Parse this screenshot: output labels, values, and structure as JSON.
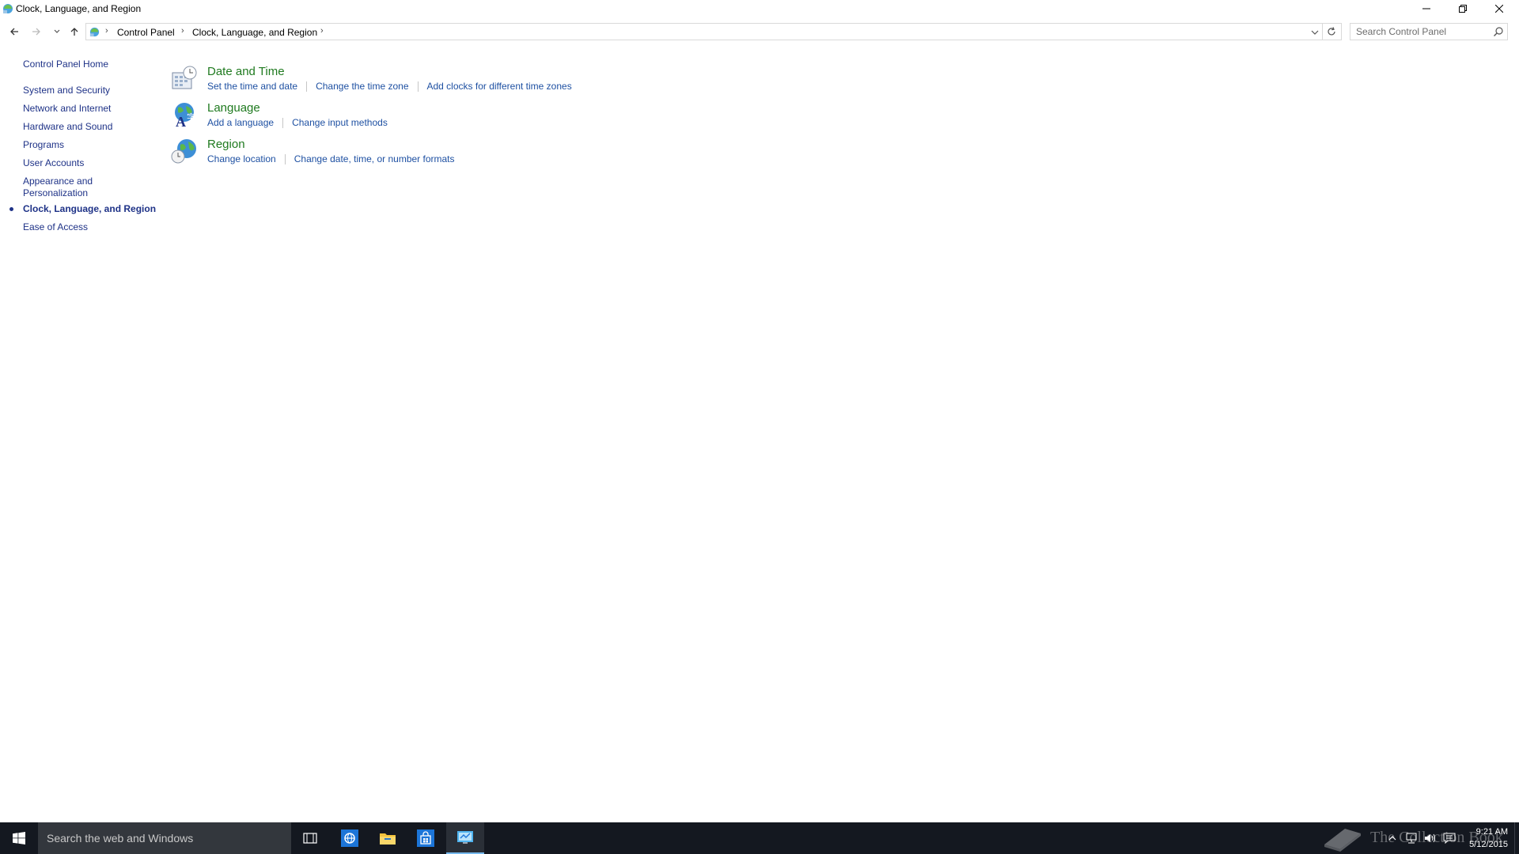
{
  "window": {
    "title": "Clock, Language, and Region",
    "icon": "control-panel-icon"
  },
  "navigation": {
    "back_icon": "back-arrow-icon",
    "forward_icon": "forward-arrow-icon",
    "recent_icon": "chevron-down-icon",
    "up_icon": "up-arrow-icon"
  },
  "address": {
    "crumbs": [
      "Control Panel",
      "Clock, Language, and Region"
    ]
  },
  "search": {
    "placeholder": "Search Control Panel"
  },
  "sidebar": {
    "items": [
      {
        "label": "Control Panel Home"
      },
      {
        "label": "System and Security"
      },
      {
        "label": "Network and Internet"
      },
      {
        "label": "Hardware and Sound"
      },
      {
        "label": "Programs"
      },
      {
        "label": "User Accounts"
      },
      {
        "label": "Appearance and",
        "label2": "Personalization"
      },
      {
        "label": "Clock, Language, and Region",
        "current": true
      },
      {
        "label": "Ease of Access"
      }
    ]
  },
  "categories": [
    {
      "title": "Date and Time",
      "icon": "date-time-icon",
      "links": [
        "Set the time and date",
        "Change the time zone",
        "Add clocks for different time zones"
      ]
    },
    {
      "title": "Language",
      "icon": "language-icon",
      "links": [
        "Add a language",
        "Change input methods"
      ]
    },
    {
      "title": "Region",
      "icon": "region-globe-icon",
      "links": [
        "Change location",
        "Change date, time, or number formats"
      ]
    }
  ],
  "taskbar": {
    "search_text": "Search the web and Windows",
    "apps": [
      "task-view-icon",
      "internet-explorer-icon",
      "file-explorer-icon",
      "store-icon",
      "control-panel-icon"
    ],
    "tray": [
      "show-hidden-icons-icon",
      "network-icon",
      "volume-icon",
      "action-center-icon"
    ],
    "time": "9:21 AM",
    "date": "5/12/2015"
  },
  "watermark": {
    "text": "The Collection Book"
  },
  "colors": {
    "link_blue": "#1e50a2",
    "sidebar_blue": "#1e3287",
    "category_green": "#1f7a1f",
    "taskbar": "#141820"
  }
}
